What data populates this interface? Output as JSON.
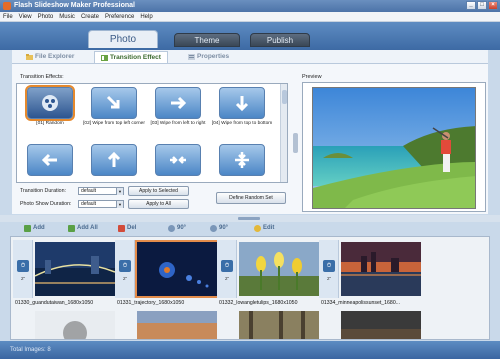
{
  "window": {
    "title": "Flash Slideshow Maker Professional"
  },
  "menu": [
    "File",
    "View",
    "Photo",
    "Music",
    "Create",
    "Preference",
    "Help"
  ],
  "main_tabs": {
    "photo": "Photo",
    "theme": "Theme",
    "publish": "Publish"
  },
  "sub_tabs": {
    "file_explorer": "File Explorer",
    "transition_effect": "Transition Effect",
    "properties": "Properties"
  },
  "transition": {
    "label": "Transition Effects:",
    "effects": [
      {
        "name": "[01] Random",
        "icon": "random-film-icon"
      },
      {
        "name": "[02] Wipe from top left corner",
        "icon": "arrow-down-right-icon"
      },
      {
        "name": "[03] Wipe from left to right",
        "icon": "arrow-right-icon"
      },
      {
        "name": "[04] Wipe from top to bottom",
        "icon": "arrow-down-icon"
      },
      {
        "name": "",
        "icon": "arrow-left-icon"
      },
      {
        "name": "",
        "icon": "arrow-up-icon"
      },
      {
        "name": "",
        "icon": "arrows-inward-icon"
      },
      {
        "name": "",
        "icon": "arrows-vertical-inward-icon"
      }
    ],
    "duration_label": "Transition Duration:",
    "duration_value": "default",
    "show_label": "Photo Show Duration:",
    "show_value": "default",
    "apply_selected": "Apply to Selected",
    "apply_all": "Apply to All",
    "define_random": "Define Random Set"
  },
  "preview": {
    "label": "Preview"
  },
  "toolbar": {
    "add": "Add",
    "add_all": "Add All",
    "del": "Del",
    "rotate_left": "90°",
    "rotate_right": "90°",
    "edit": "Edit"
  },
  "photos": [
    {
      "name": "01330_guandutaiwan_1680x1050",
      "duration": "2\""
    },
    {
      "name": "01331_trajectory_1680x1050",
      "duration": "2\""
    },
    {
      "name": "01332_lowangletulips_1680x1050",
      "duration": "2\""
    },
    {
      "name": "01334_minneapolissunset_1680...",
      "duration": "2\""
    }
  ],
  "status": {
    "total_images": "Total Images: 8"
  },
  "colors": {
    "accent": "#3d6aa4",
    "selection": "#e5892d"
  }
}
